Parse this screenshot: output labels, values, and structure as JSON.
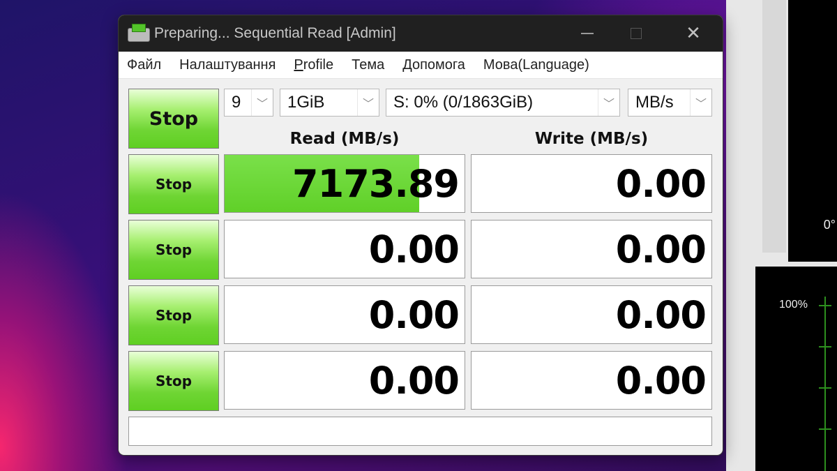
{
  "window": {
    "title": "Preparing... Sequential Read [Admin]"
  },
  "menu": {
    "items": [
      "Файл",
      "Налаштування",
      "Profile",
      "Тема",
      "Допомога",
      "Мова(Language)"
    ]
  },
  "controls": {
    "all_button": "Stop",
    "count": "9",
    "size": "1GiB",
    "drive": "S: 0% (0/1863GiB)",
    "unit": "MB/s"
  },
  "columns": {
    "read": "Read (MB/s)",
    "write": "Write (MB/s)"
  },
  "rows": [
    {
      "button": "Stop",
      "read": "7173.89",
      "write": "0.00",
      "read_fill_fraction": 0.81
    },
    {
      "button": "Stop",
      "read": "0.00",
      "write": "0.00",
      "read_fill_fraction": 0
    },
    {
      "button": "Stop",
      "read": "0.00",
      "write": "0.00",
      "read_fill_fraction": 0
    },
    {
      "button": "Stop",
      "read": "0.00",
      "write": "0.00",
      "read_fill_fraction": 0
    }
  ],
  "side_monitor": {
    "top_label": "0°",
    "bottom_label": "100%"
  },
  "colors": {
    "accent_green": "#60d028",
    "titlebar": "#202020"
  },
  "icons": {
    "app": "disk-icon",
    "minimize": "minimize-icon",
    "maximize": "maximize-icon",
    "close": "close-icon",
    "dropdown": "chevron-down-icon"
  }
}
